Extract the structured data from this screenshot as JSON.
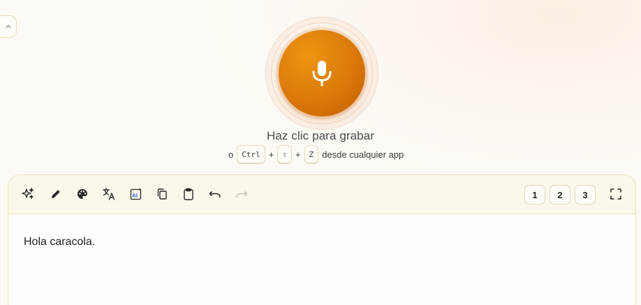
{
  "record": {
    "title": "Haz clic para grabar",
    "prefix": "o",
    "keys": [
      "Ctrl",
      "⇧",
      "Z"
    ],
    "plus": "+",
    "suffix": "desde cualquier app"
  },
  "toolbar": {
    "tools": [
      "sparkles-icon",
      "pencil-icon",
      "palette-icon",
      "translate-icon",
      "ai-image-icon",
      "copy-icon",
      "clipboard-icon",
      "undo-icon",
      "redo-icon"
    ],
    "slots": [
      "1",
      "2",
      "3"
    ],
    "fullscreen": "fullscreen-icon"
  },
  "editor": {
    "content": "Hola caracola."
  },
  "colors": {
    "accent": "#de7e0b",
    "accent_dark": "#c45f05",
    "border": "#ecdfbc",
    "background": "#fdfaf5"
  }
}
